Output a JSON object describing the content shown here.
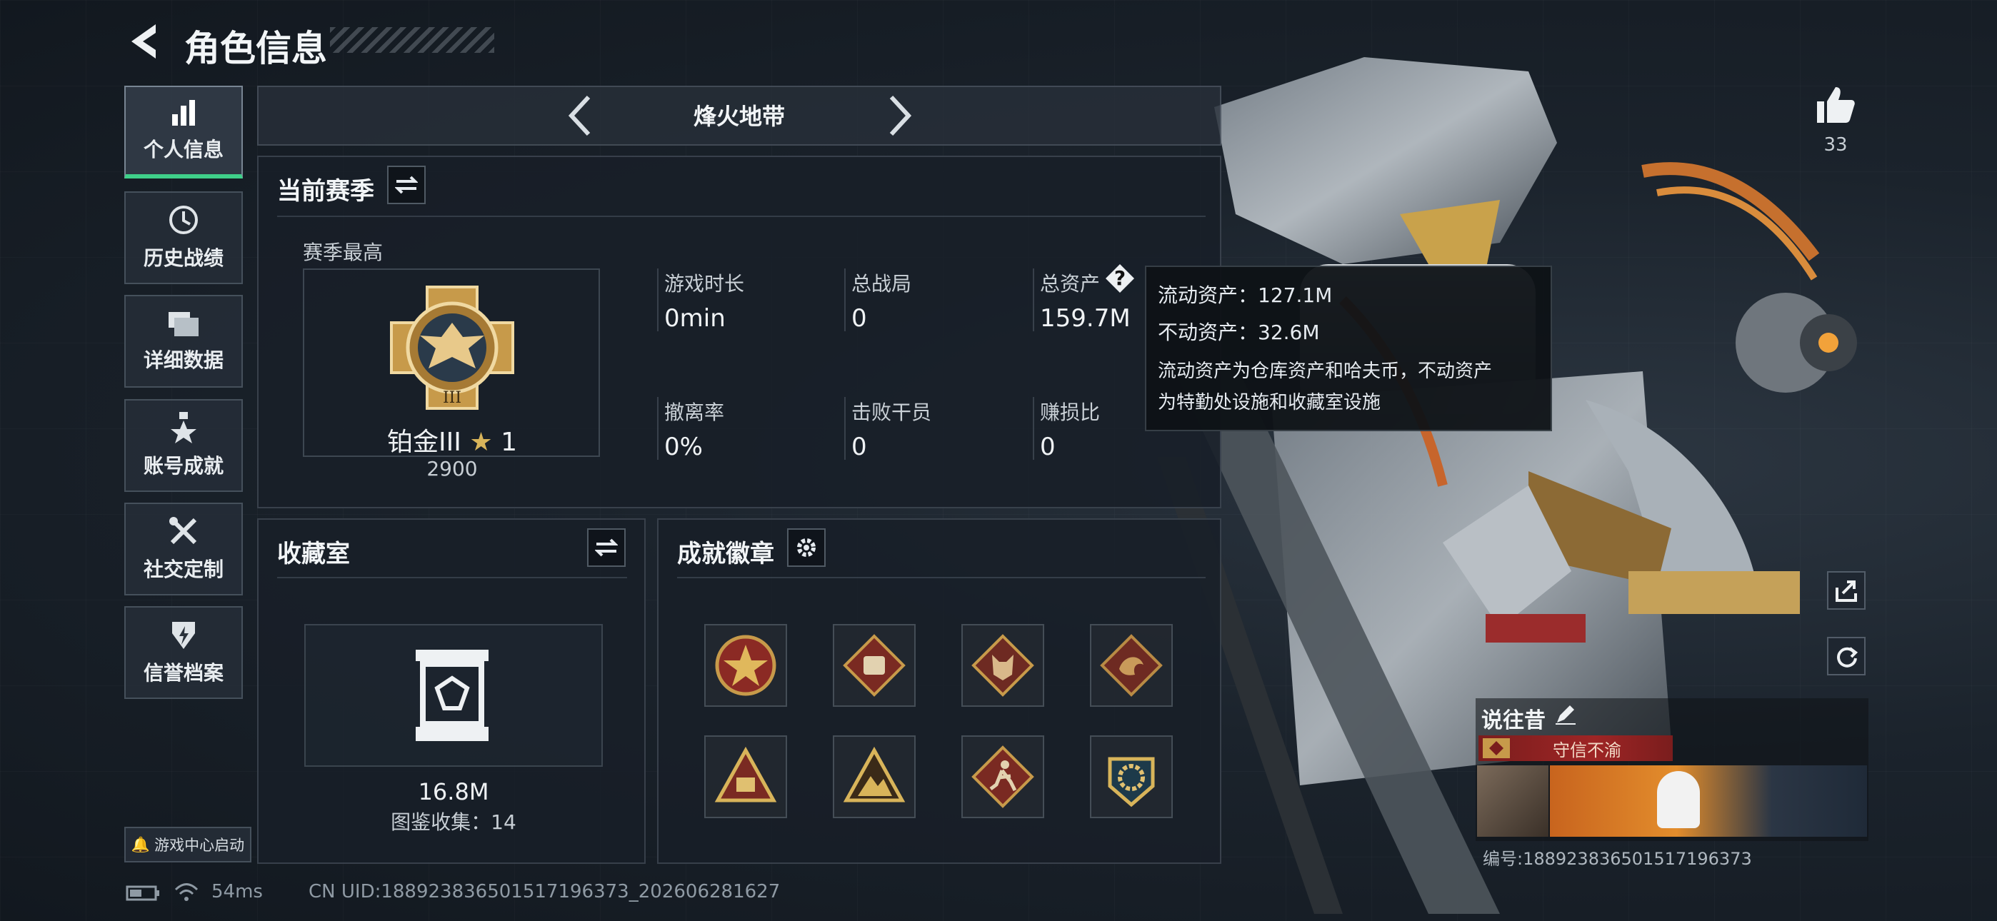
{
  "header": {
    "title": "角色信息"
  },
  "sidebar": {
    "items": [
      {
        "label": "个人信息",
        "icon": "bar-chart-icon",
        "active": true
      },
      {
        "label": "历史战绩",
        "icon": "clock-icon"
      },
      {
        "label": "详细数据",
        "icon": "folder-icon"
      },
      {
        "label": "账号成就",
        "icon": "medal-icon"
      },
      {
        "label": "社交定制",
        "icon": "tools-icon"
      },
      {
        "label": "信誉档案",
        "icon": "shield-icon"
      }
    ],
    "launcher": "游戏中心启动"
  },
  "mode_selector": {
    "label": "烽火地带"
  },
  "season": {
    "title": "当前赛季",
    "best_label": "赛季最高",
    "rank_name": "铂金III",
    "rank_stars": "1",
    "rank_points": "2900",
    "stats": [
      {
        "label": "游戏时长",
        "value": "0min"
      },
      {
        "label": "总战局",
        "value": "0"
      },
      {
        "label": "总资产",
        "value": "159.7M"
      },
      {
        "label": "撤离率",
        "value": "0%"
      },
      {
        "label": "击败干员",
        "value": "0"
      },
      {
        "label": "赚损比",
        "value": "0"
      }
    ]
  },
  "tooltip": {
    "liquid": "流动资产：127.1M",
    "fixed": "不动资产：32.6M",
    "desc_line1": "流动资产为仓库资产和哈夫币，不动资产",
    "desc_line2": "为特勤处设施和收藏室设施"
  },
  "collection": {
    "title": "收藏室",
    "value": "16.8M",
    "count_label": "图鉴收集：14"
  },
  "badges": {
    "title": "成就徽章",
    "items": [
      "star-badge-icon",
      "fist-badge-icon",
      "wolf-badge-icon",
      "dragon-badge-icon",
      "triangle-badge-icon",
      "mountain-badge-icon",
      "runner-badge-icon",
      "gear-badge-icon"
    ]
  },
  "right": {
    "likes": "33",
    "player_name": "说往昔",
    "title_tag": "守信不渝",
    "player_id": "编号:188923836501517196373"
  },
  "status_bar": {
    "ping": "54ms",
    "uid": "CN UID:188923836501517196373_202606281627"
  },
  "colors": {
    "accent_green": "#3fd08a",
    "gold": "#c79a4a",
    "tag_red": "#8b1f1f"
  }
}
